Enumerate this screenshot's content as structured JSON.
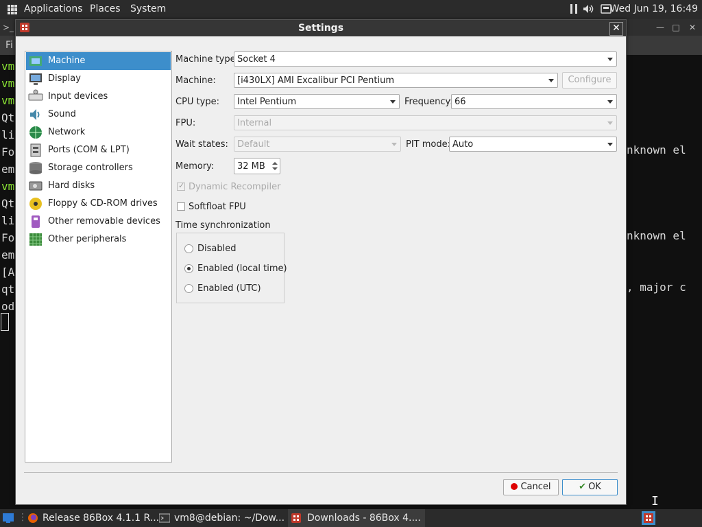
{
  "top_panel": {
    "applications": "Applications",
    "places": "Places",
    "system": "System",
    "clock": "Wed Jun 19, 16:49"
  },
  "terminal": {
    "lines_left": [
      "vm",
      "vm",
      "vm",
      "Qt",
      "li",
      "Fo",
      "em",
      "vm",
      "Qt",
      "li",
      "Fo",
      "em",
      "[A",
      "qt",
      "od"
    ],
    "right_1": "nknown el",
    "right_2": "nknown el",
    "right_3": ", major c",
    "menu_first": "Fi"
  },
  "dialog": {
    "title": "Settings",
    "close": "✕",
    "categories": [
      {
        "label": "Machine",
        "icon": "machine-icon"
      },
      {
        "label": "Display",
        "icon": "display-icon"
      },
      {
        "label": "Input devices",
        "icon": "keyboard-icon"
      },
      {
        "label": "Sound",
        "icon": "sound-icon"
      },
      {
        "label": "Network",
        "icon": "network-icon"
      },
      {
        "label": "Ports (COM & LPT)",
        "icon": "ports-icon"
      },
      {
        "label": "Storage controllers",
        "icon": "storage-icon"
      },
      {
        "label": "Hard disks",
        "icon": "hard-disk-icon"
      },
      {
        "label": "Floppy & CD-ROM drives",
        "icon": "floppy-cdrom-icon"
      },
      {
        "label": "Other removable devices",
        "icon": "removable-device-icon"
      },
      {
        "label": "Other peripherals",
        "icon": "peripherals-icon"
      }
    ],
    "selected_category": "Machine",
    "form": {
      "machine_type_label": "Machine type:",
      "machine_type_value": "Socket 4",
      "machine_label": "Machine:",
      "machine_value": "[i430LX] AMI Excalibur PCI Pentium",
      "configure_label": "Configure",
      "cpu_type_label": "CPU type:",
      "cpu_type_value": "Intel Pentium",
      "frequency_label": "Frequency:",
      "frequency_value": "66",
      "fpu_label": "FPU:",
      "fpu_value": "Internal",
      "wait_states_label": "Wait states:",
      "wait_states_value": "Default",
      "pit_mode_label": "PIT mode:",
      "pit_mode_value": "Auto",
      "memory_label": "Memory:",
      "memory_value": "32 MB",
      "dynamic_recompiler_label": "Dynamic Recompiler",
      "dynamic_recompiler_checked": true,
      "softfloat_label": "Softfloat FPU",
      "softfloat_checked": false,
      "time_sync_label": "Time synchronization",
      "time_sync_options": [
        "Disabled",
        "Enabled (local time)",
        "Enabled (UTC)"
      ],
      "time_sync_selected": "Enabled (local time)"
    },
    "buttons": {
      "cancel": "Cancel",
      "ok": "OK"
    }
  },
  "taskbar": {
    "tasks": [
      {
        "label": "Release 86Box 4.1.1 R...",
        "icon": "firefox-icon"
      },
      {
        "label": "vm8@debian: ~/Dow...",
        "icon": "terminal-icon"
      },
      {
        "label": "Downloads - 86Box 4....",
        "icon": "86box-icon"
      }
    ]
  },
  "colors": {
    "selection": "#3d8ecb",
    "panel": "#2b2b2b",
    "terminal_green": "#8ae234"
  }
}
